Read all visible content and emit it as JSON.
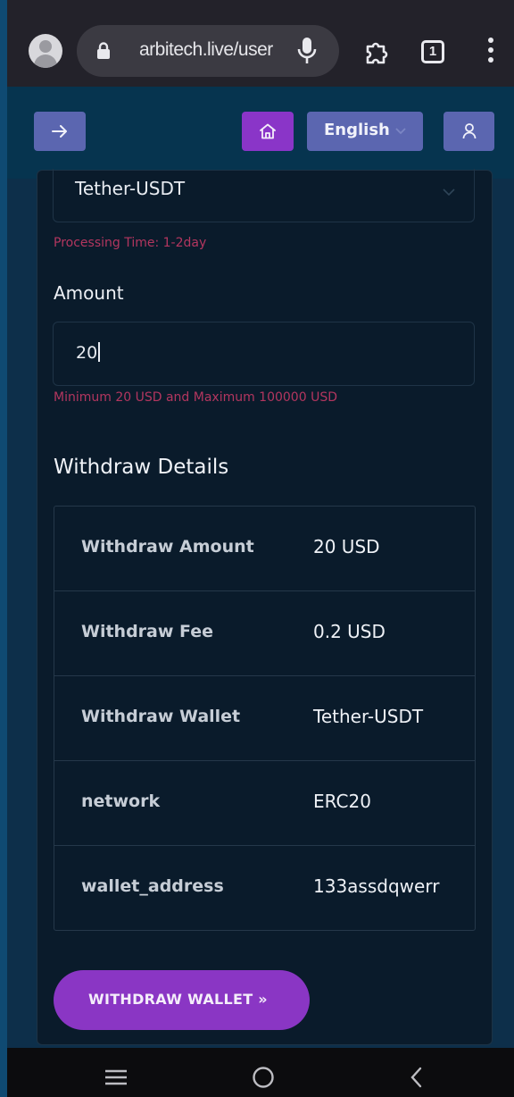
{
  "browser": {
    "url": "arbitech.live/user",
    "tab_count": "1"
  },
  "header": {
    "language": "English"
  },
  "form": {
    "wallet_selected": "Tether-USDT",
    "processing_time": "Processing Time: 1-2day",
    "amount_label": "Amount",
    "amount_value": "20",
    "amount_hint": "Minimum 20 USD and Maximum 100000 USD"
  },
  "details": {
    "title": "Withdraw Details",
    "rows": [
      {
        "key": "Withdraw Amount",
        "value": "20 USD"
      },
      {
        "key": "Withdraw Fee",
        "value": "0.2 USD"
      },
      {
        "key": "Withdraw Wallet",
        "value": "Tether-USDT"
      },
      {
        "key": "network",
        "value": "ERC20"
      },
      {
        "key": "wallet_address",
        "value": "133assdqwerr"
      }
    ]
  },
  "actions": {
    "withdraw_label": "WITHDRAW WALLET »"
  },
  "icons": {
    "accent_purple": "#8a36c4",
    "header_button": "#5b66b0",
    "hint_color": "#b3365f"
  }
}
